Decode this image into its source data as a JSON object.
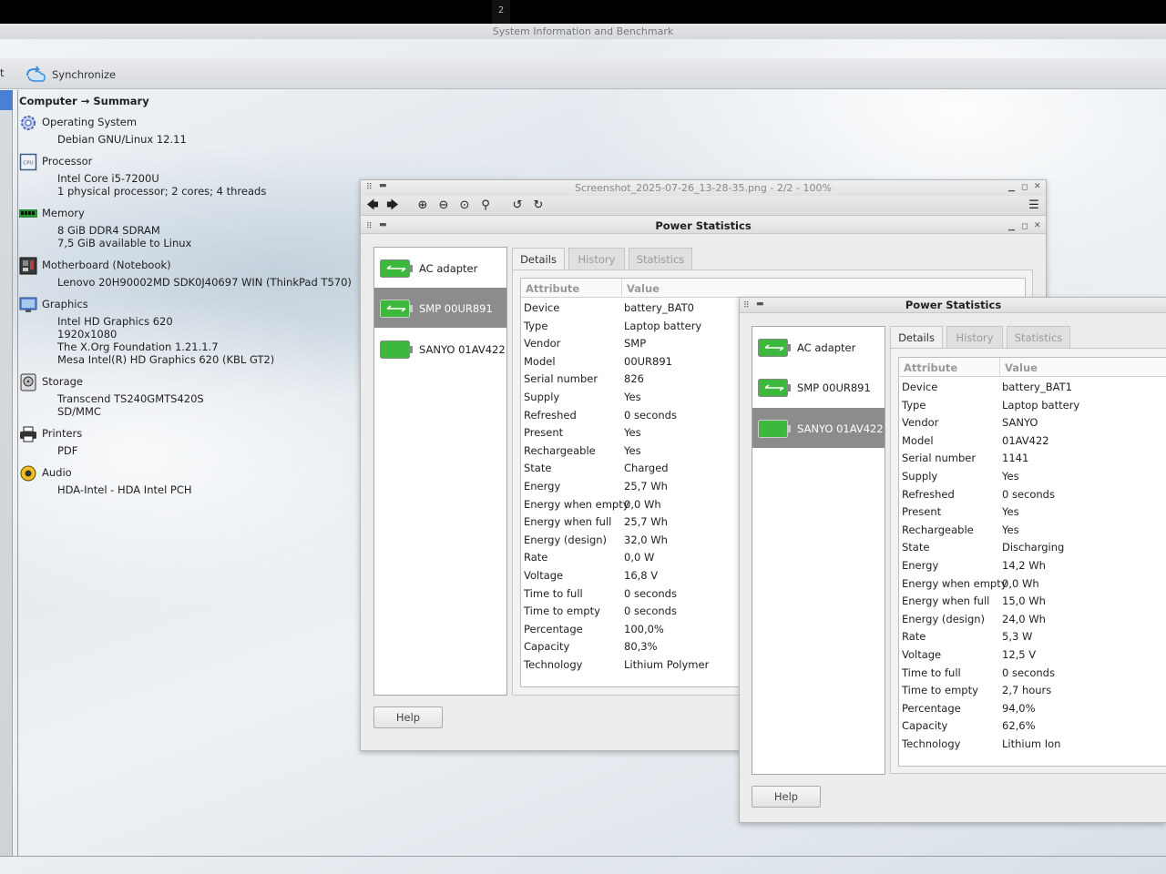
{
  "workspace_number": "2",
  "window_title": "System Information and Benchmark",
  "toolbar": {
    "stub_label": "t",
    "synchronize_label": "Synchronize"
  },
  "summary": {
    "breadcrumb": "Computer → Summary",
    "sections": [
      {
        "label": "Operating System",
        "icon": "gear-icon",
        "lines": [
          "Debian GNU/Linux 12.11"
        ]
      },
      {
        "label": "Processor",
        "icon": "cpu-icon",
        "lines": [
          "Intel Core i5-7200U",
          "1 physical processor; 2 cores; 4 threads"
        ]
      },
      {
        "label": "Memory",
        "icon": "memory-icon",
        "lines": [
          "8 GiB DDR4 SDRAM",
          "7,5 GiB available to Linux"
        ]
      },
      {
        "label": "Motherboard (Notebook)",
        "icon": "motherboard-icon",
        "lines": [
          "Lenovo 20H90002MD SDK0J40697 WIN (ThinkPad T570)"
        ]
      },
      {
        "label": "Graphics",
        "icon": "monitor-icon",
        "lines": [
          "Intel HD Graphics 620",
          "1920x1080",
          "The X.Org Foundation 1.21.1.7",
          "Mesa Intel(R) HD Graphics 620 (KBL GT2)"
        ]
      },
      {
        "label": "Storage",
        "icon": "disk-icon",
        "lines": [
          "Transcend TS240GMTS420S",
          "SD/MMC"
        ]
      },
      {
        "label": "Printers",
        "icon": "printer-icon",
        "lines": [
          "PDF"
        ]
      },
      {
        "label": "Audio",
        "icon": "speaker-icon",
        "lines": [
          "HDA-Intel - HDA Intel PCH"
        ]
      }
    ]
  },
  "viewer": {
    "title": "Screenshot_2025-07-26_13-28-35.png - 2/2 - 100%"
  },
  "power1": {
    "title": "Power Statistics",
    "devices": [
      "AC adapter",
      "SMP 00UR891",
      "SANYO 01AV422"
    ],
    "selected_index": 1,
    "tabs": [
      "Details",
      "History",
      "Statistics"
    ],
    "columns": [
      "Attribute",
      "Value"
    ],
    "rows": [
      [
        "Device",
        "battery_BAT0"
      ],
      [
        "Type",
        "Laptop battery"
      ],
      [
        "Vendor",
        "SMP"
      ],
      [
        "Model",
        "00UR891"
      ],
      [
        "Serial number",
        "826"
      ],
      [
        "Supply",
        "Yes"
      ],
      [
        "Refreshed",
        "0 seconds"
      ],
      [
        "Present",
        "Yes"
      ],
      [
        "Rechargeable",
        "Yes"
      ],
      [
        "State",
        "Charged"
      ],
      [
        "Energy",
        "25,7 Wh"
      ],
      [
        "Energy when empty",
        "0,0 Wh"
      ],
      [
        "Energy when full",
        "25,7 Wh"
      ],
      [
        "Energy (design)",
        "32,0 Wh"
      ],
      [
        "Rate",
        "0,0 W"
      ],
      [
        "Voltage",
        "16,8 V"
      ],
      [
        "Time to full",
        "0 seconds"
      ],
      [
        "Time to empty",
        "0 seconds"
      ],
      [
        "Percentage",
        "100,0%"
      ],
      [
        "Capacity",
        "80,3%"
      ],
      [
        "Technology",
        "Lithium Polymer"
      ]
    ],
    "help_label": "Help"
  },
  "power2": {
    "title": "Power Statistics",
    "devices": [
      "AC adapter",
      "SMP 00UR891",
      "SANYO 01AV422"
    ],
    "selected_index": 2,
    "tabs": [
      "Details",
      "History",
      "Statistics"
    ],
    "columns": [
      "Attribute",
      "Value"
    ],
    "rows": [
      [
        "Device",
        "battery_BAT1"
      ],
      [
        "Type",
        "Laptop battery"
      ],
      [
        "Vendor",
        "SANYO"
      ],
      [
        "Model",
        "01AV422"
      ],
      [
        "Serial number",
        "1141"
      ],
      [
        "Supply",
        "Yes"
      ],
      [
        "Refreshed",
        "0 seconds"
      ],
      [
        "Present",
        "Yes"
      ],
      [
        "Rechargeable",
        "Yes"
      ],
      [
        "State",
        "Discharging"
      ],
      [
        "Energy",
        "14,2 Wh"
      ],
      [
        "Energy when empty",
        "0,0 Wh"
      ],
      [
        "Energy when full",
        "15,0 Wh"
      ],
      [
        "Energy (design)",
        "24,0 Wh"
      ],
      [
        "Rate",
        "5,3 W"
      ],
      [
        "Voltage",
        "12,5 V"
      ],
      [
        "Time to full",
        "0 seconds"
      ],
      [
        "Time to empty",
        "2,7 hours"
      ],
      [
        "Percentage",
        "94,0%"
      ],
      [
        "Capacity",
        "62,6%"
      ],
      [
        "Technology",
        "Lithium Ion"
      ]
    ],
    "help_label": "Help"
  },
  "colors": {
    "accent": "#4a7fd6",
    "battery_green": "#3cb93c",
    "selection_gray": "#8c8c8c"
  }
}
